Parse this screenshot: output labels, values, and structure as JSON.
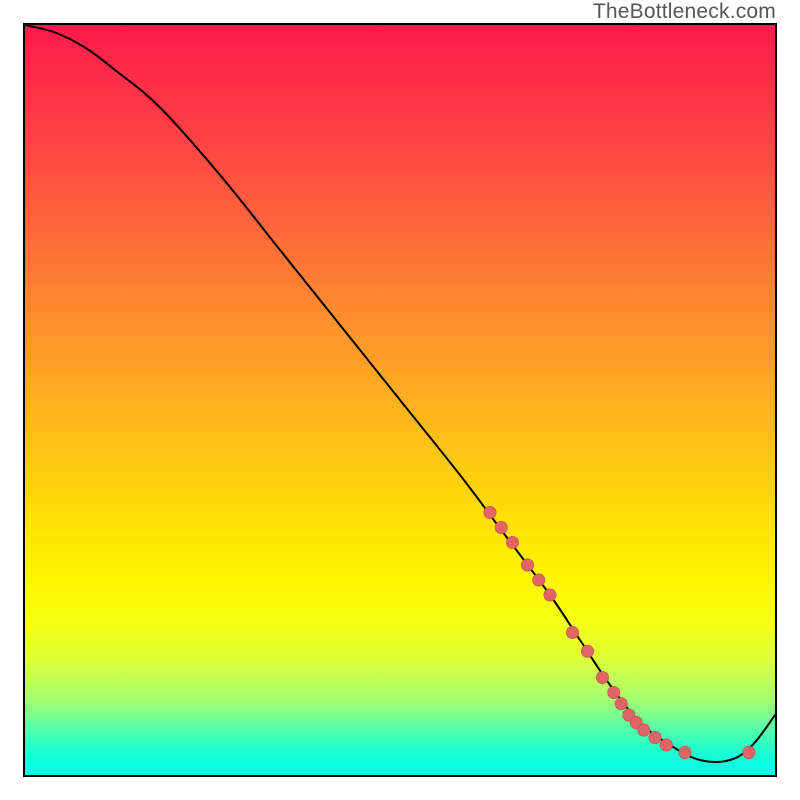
{
  "watermark": "TheBottleneck.com",
  "colors": {
    "curve_stroke": "#000000",
    "marker_fill": "#e06666",
    "marker_stroke": "#c24d4d",
    "gradient_top": "#ff1a4b",
    "gradient_bottom": "#00ffe6"
  },
  "chart_data": {
    "type": "line",
    "title": "",
    "xlabel": "",
    "ylabel": "",
    "xlim": [
      0,
      100
    ],
    "ylim": [
      0,
      100
    ],
    "grid": false,
    "legend": false,
    "series": [
      {
        "name": "curve",
        "x": [
          0,
          4,
          8,
          12,
          18,
          26,
          34,
          42,
          50,
          58,
          64,
          70,
          74,
          78,
          82,
          86,
          90,
          94,
          97,
          100
        ],
        "y": [
          100,
          99,
          97,
          94,
          89,
          80,
          70,
          60,
          50,
          40,
          32,
          24,
          18,
          12,
          7,
          4,
          2,
          2,
          4,
          8
        ]
      }
    ],
    "markers": {
      "name": "highlighted-points",
      "x": [
        62,
        63.5,
        65,
        67,
        68.5,
        70,
        73,
        75,
        77,
        78.5,
        79.5,
        80.5,
        81.5,
        82.5,
        84,
        85.5,
        88,
        96.5
      ],
      "y": [
        35,
        33,
        31,
        28,
        26,
        24,
        19,
        16.5,
        13,
        11,
        9.5,
        8,
        7,
        6,
        5,
        4,
        3,
        3
      ]
    }
  }
}
